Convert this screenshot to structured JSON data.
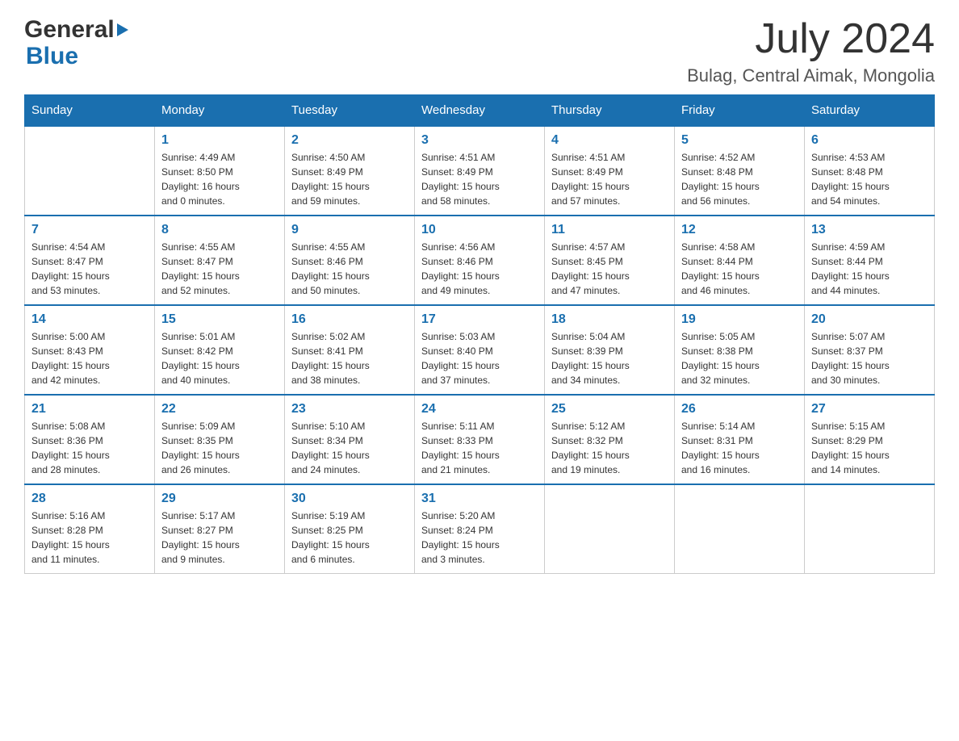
{
  "header": {
    "logo_general": "General",
    "logo_blue": "Blue",
    "title": "July 2024",
    "subtitle": "Bulag, Central Aimak, Mongolia"
  },
  "weekdays": [
    "Sunday",
    "Monday",
    "Tuesday",
    "Wednesday",
    "Thursday",
    "Friday",
    "Saturday"
  ],
  "weeks": [
    [
      {
        "day": "",
        "details": ""
      },
      {
        "day": "1",
        "details": "Sunrise: 4:49 AM\nSunset: 8:50 PM\nDaylight: 16 hours\nand 0 minutes."
      },
      {
        "day": "2",
        "details": "Sunrise: 4:50 AM\nSunset: 8:49 PM\nDaylight: 15 hours\nand 59 minutes."
      },
      {
        "day": "3",
        "details": "Sunrise: 4:51 AM\nSunset: 8:49 PM\nDaylight: 15 hours\nand 58 minutes."
      },
      {
        "day": "4",
        "details": "Sunrise: 4:51 AM\nSunset: 8:49 PM\nDaylight: 15 hours\nand 57 minutes."
      },
      {
        "day": "5",
        "details": "Sunrise: 4:52 AM\nSunset: 8:48 PM\nDaylight: 15 hours\nand 56 minutes."
      },
      {
        "day": "6",
        "details": "Sunrise: 4:53 AM\nSunset: 8:48 PM\nDaylight: 15 hours\nand 54 minutes."
      }
    ],
    [
      {
        "day": "7",
        "details": "Sunrise: 4:54 AM\nSunset: 8:47 PM\nDaylight: 15 hours\nand 53 minutes."
      },
      {
        "day": "8",
        "details": "Sunrise: 4:55 AM\nSunset: 8:47 PM\nDaylight: 15 hours\nand 52 minutes."
      },
      {
        "day": "9",
        "details": "Sunrise: 4:55 AM\nSunset: 8:46 PM\nDaylight: 15 hours\nand 50 minutes."
      },
      {
        "day": "10",
        "details": "Sunrise: 4:56 AM\nSunset: 8:46 PM\nDaylight: 15 hours\nand 49 minutes."
      },
      {
        "day": "11",
        "details": "Sunrise: 4:57 AM\nSunset: 8:45 PM\nDaylight: 15 hours\nand 47 minutes."
      },
      {
        "day": "12",
        "details": "Sunrise: 4:58 AM\nSunset: 8:44 PM\nDaylight: 15 hours\nand 46 minutes."
      },
      {
        "day": "13",
        "details": "Sunrise: 4:59 AM\nSunset: 8:44 PM\nDaylight: 15 hours\nand 44 minutes."
      }
    ],
    [
      {
        "day": "14",
        "details": "Sunrise: 5:00 AM\nSunset: 8:43 PM\nDaylight: 15 hours\nand 42 minutes."
      },
      {
        "day": "15",
        "details": "Sunrise: 5:01 AM\nSunset: 8:42 PM\nDaylight: 15 hours\nand 40 minutes."
      },
      {
        "day": "16",
        "details": "Sunrise: 5:02 AM\nSunset: 8:41 PM\nDaylight: 15 hours\nand 38 minutes."
      },
      {
        "day": "17",
        "details": "Sunrise: 5:03 AM\nSunset: 8:40 PM\nDaylight: 15 hours\nand 37 minutes."
      },
      {
        "day": "18",
        "details": "Sunrise: 5:04 AM\nSunset: 8:39 PM\nDaylight: 15 hours\nand 34 minutes."
      },
      {
        "day": "19",
        "details": "Sunrise: 5:05 AM\nSunset: 8:38 PM\nDaylight: 15 hours\nand 32 minutes."
      },
      {
        "day": "20",
        "details": "Sunrise: 5:07 AM\nSunset: 8:37 PM\nDaylight: 15 hours\nand 30 minutes."
      }
    ],
    [
      {
        "day": "21",
        "details": "Sunrise: 5:08 AM\nSunset: 8:36 PM\nDaylight: 15 hours\nand 28 minutes."
      },
      {
        "day": "22",
        "details": "Sunrise: 5:09 AM\nSunset: 8:35 PM\nDaylight: 15 hours\nand 26 minutes."
      },
      {
        "day": "23",
        "details": "Sunrise: 5:10 AM\nSunset: 8:34 PM\nDaylight: 15 hours\nand 24 minutes."
      },
      {
        "day": "24",
        "details": "Sunrise: 5:11 AM\nSunset: 8:33 PM\nDaylight: 15 hours\nand 21 minutes."
      },
      {
        "day": "25",
        "details": "Sunrise: 5:12 AM\nSunset: 8:32 PM\nDaylight: 15 hours\nand 19 minutes."
      },
      {
        "day": "26",
        "details": "Sunrise: 5:14 AM\nSunset: 8:31 PM\nDaylight: 15 hours\nand 16 minutes."
      },
      {
        "day": "27",
        "details": "Sunrise: 5:15 AM\nSunset: 8:29 PM\nDaylight: 15 hours\nand 14 minutes."
      }
    ],
    [
      {
        "day": "28",
        "details": "Sunrise: 5:16 AM\nSunset: 8:28 PM\nDaylight: 15 hours\nand 11 minutes."
      },
      {
        "day": "29",
        "details": "Sunrise: 5:17 AM\nSunset: 8:27 PM\nDaylight: 15 hours\nand 9 minutes."
      },
      {
        "day": "30",
        "details": "Sunrise: 5:19 AM\nSunset: 8:25 PM\nDaylight: 15 hours\nand 6 minutes."
      },
      {
        "day": "31",
        "details": "Sunrise: 5:20 AM\nSunset: 8:24 PM\nDaylight: 15 hours\nand 3 minutes."
      },
      {
        "day": "",
        "details": ""
      },
      {
        "day": "",
        "details": ""
      },
      {
        "day": "",
        "details": ""
      }
    ]
  ]
}
